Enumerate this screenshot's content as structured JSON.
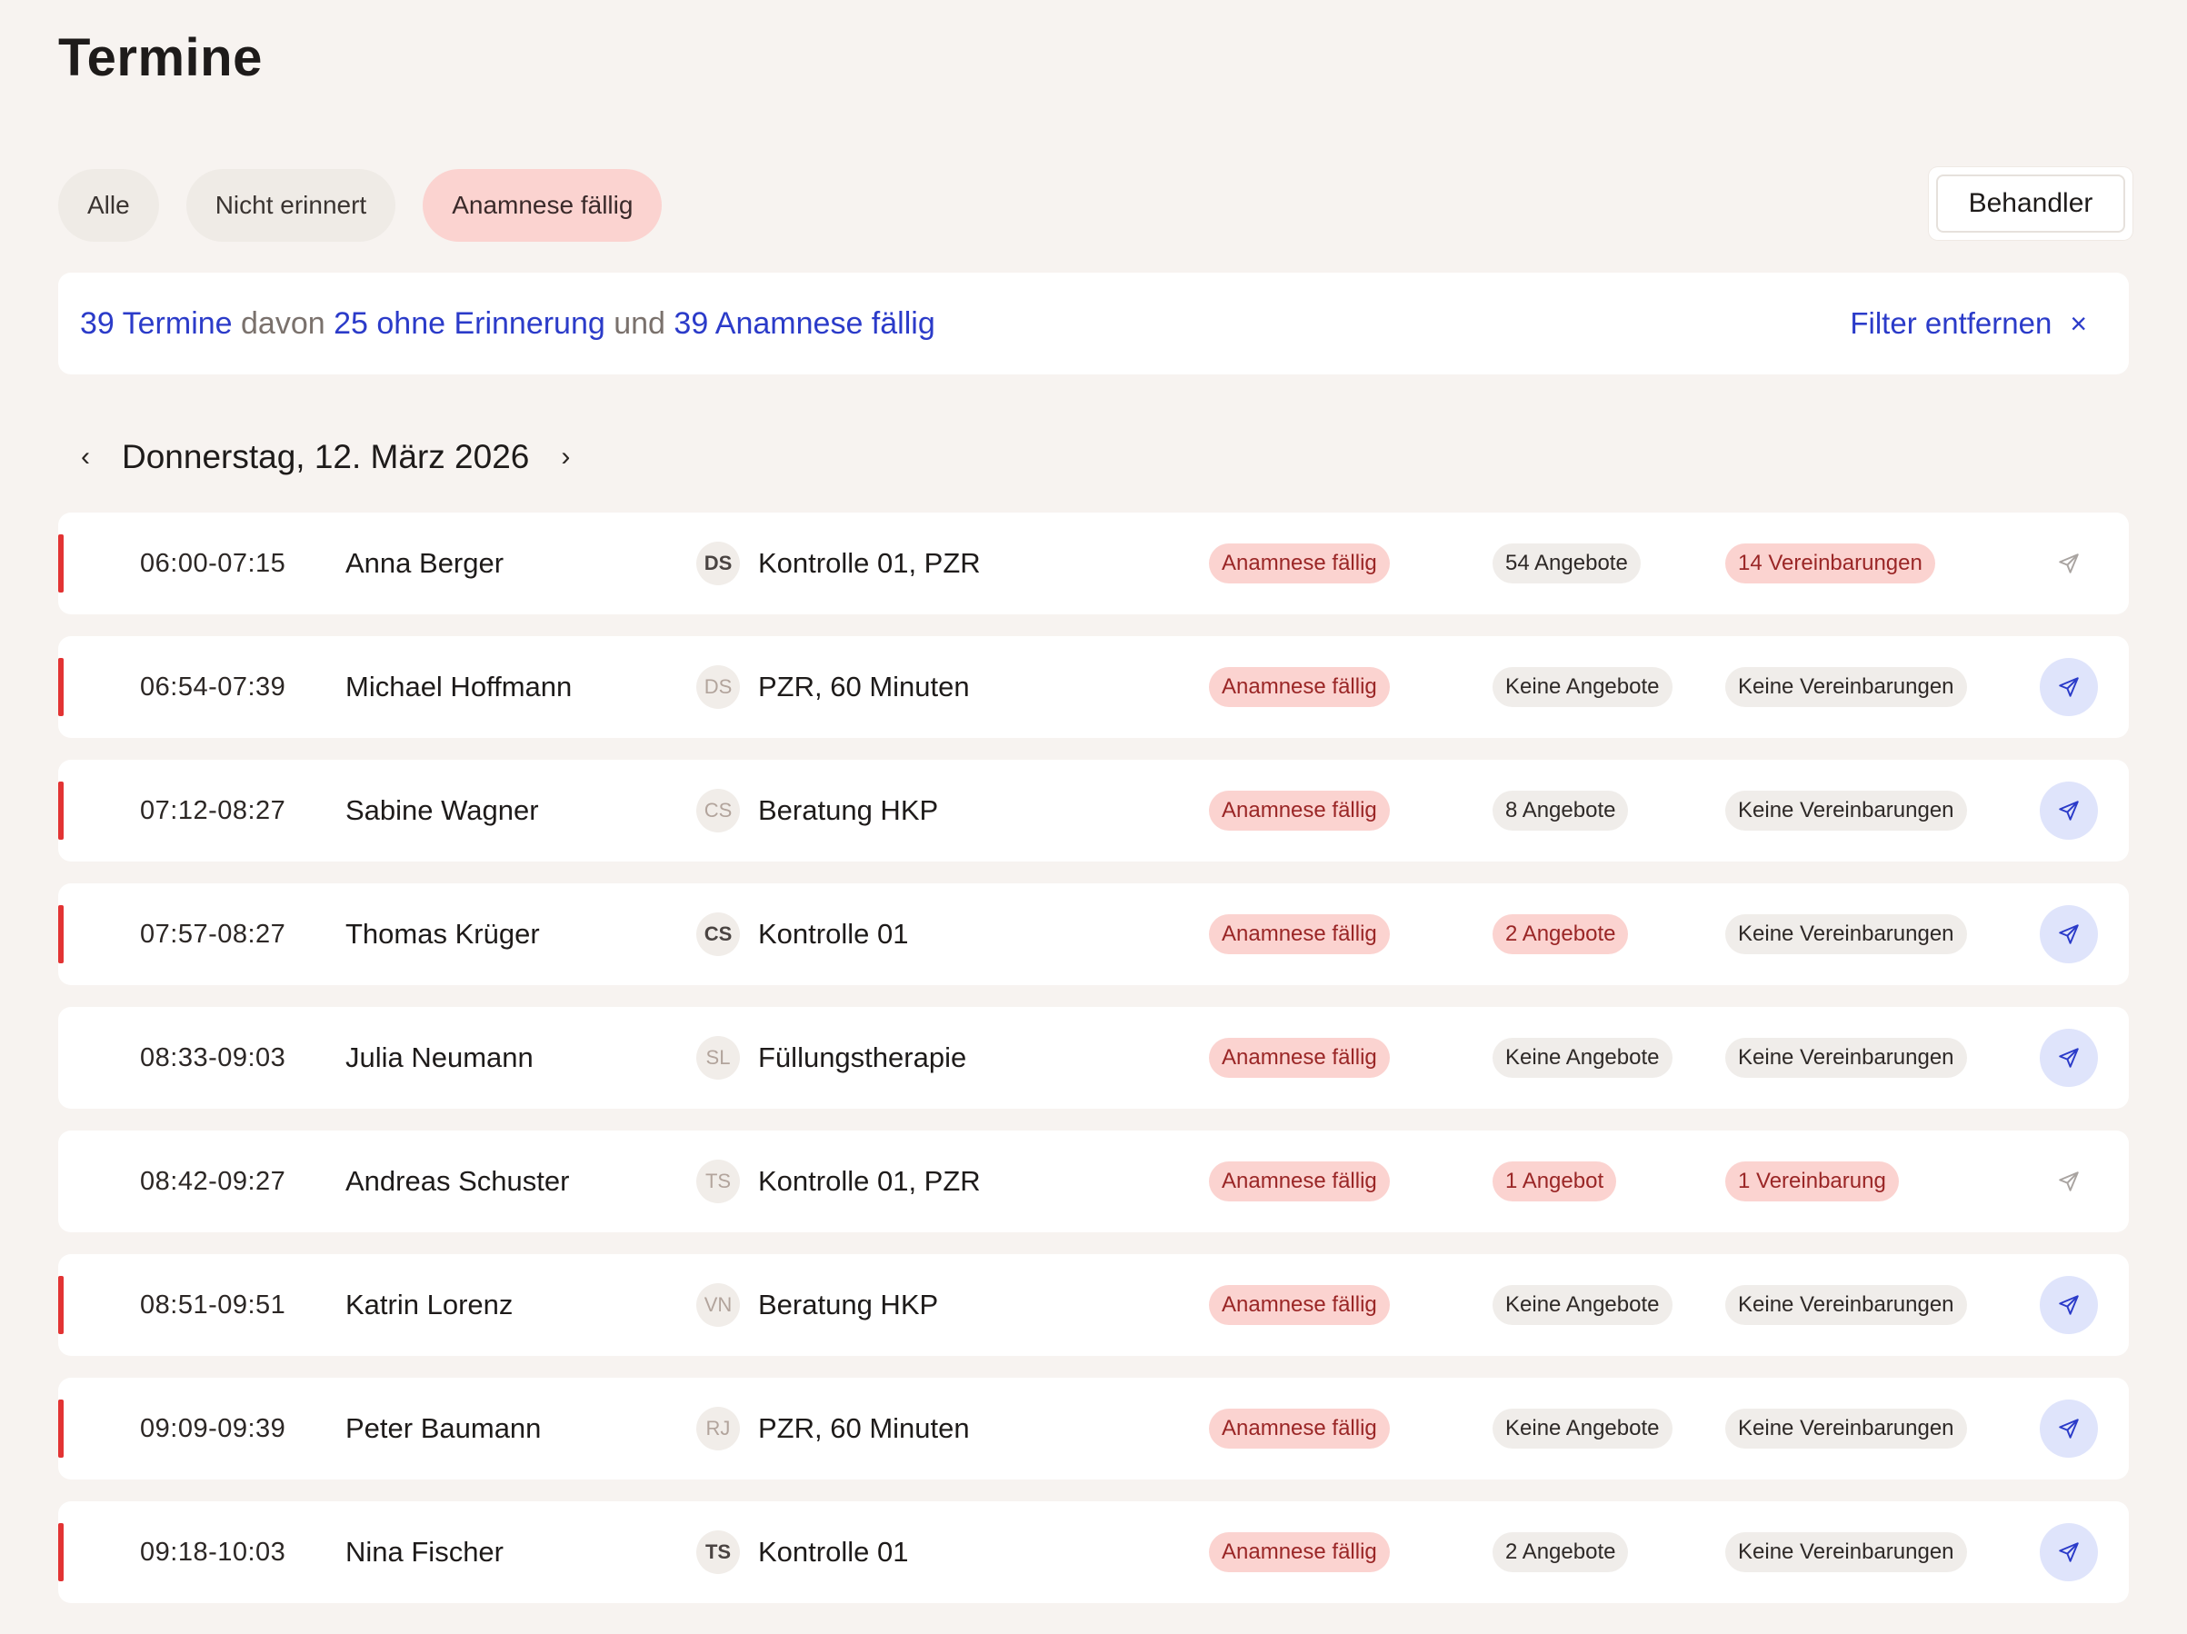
{
  "page": {
    "title": "Termine"
  },
  "filters": [
    {
      "label": "Alle",
      "active": false
    },
    {
      "label": "Nicht erinnert",
      "active": false
    },
    {
      "label": "Anamnese fällig",
      "active": true
    }
  ],
  "behandler": {
    "label": "Behandler"
  },
  "summary": {
    "part1": "39 Termine",
    "sep1": " davon ",
    "part2": "25 ohne Erinnerung",
    "sep2": " und ",
    "part3": "39 Anamnese fällig",
    "clear_label": "Filter entfernen",
    "clear_icon": "×"
  },
  "datenav": {
    "prev_icon": "‹",
    "date": "Donnerstag, 12. März 2026",
    "next_icon": "›"
  },
  "rows": [
    {
      "time": "06:00-07:15",
      "name": "Anna Berger",
      "avatar": "DS",
      "avatar_strong": true,
      "treatment": "Kontrolle 01, PZR",
      "anamnese": "Anamnese fällig",
      "angebote": "54 Angebote",
      "angebote_red": false,
      "vereinbarungen": "14 Vereinbarungen",
      "vereinbarungen_red": true,
      "marker": true,
      "send_active": false
    },
    {
      "time": "06:54-07:39",
      "name": "Michael Hoffmann",
      "avatar": "DS",
      "avatar_strong": false,
      "treatment": "PZR, 60 Minuten",
      "anamnese": "Anamnese fällig",
      "angebote": "Keine Angebote",
      "angebote_red": false,
      "vereinbarungen": "Keine Vereinbarungen",
      "vereinbarungen_red": false,
      "marker": true,
      "send_active": true
    },
    {
      "time": "07:12-08:27",
      "name": "Sabine Wagner",
      "avatar": "CS",
      "avatar_strong": false,
      "treatment": "Beratung HKP",
      "anamnese": "Anamnese fällig",
      "angebote": "8 Angebote",
      "angebote_red": false,
      "vereinbarungen": "Keine Vereinbarungen",
      "vereinbarungen_red": false,
      "marker": true,
      "send_active": true
    },
    {
      "time": "07:57-08:27",
      "name": "Thomas Krüger",
      "avatar": "CS",
      "avatar_strong": true,
      "treatment": "Kontrolle 01",
      "anamnese": "Anamnese fällig",
      "angebote": "2 Angebote",
      "angebote_red": true,
      "vereinbarungen": "Keine Vereinbarungen",
      "vereinbarungen_red": false,
      "marker": true,
      "send_active": true
    },
    {
      "time": "08:33-09:03",
      "name": "Julia Neumann",
      "avatar": "SL",
      "avatar_strong": false,
      "treatment": "Füllungstherapie",
      "anamnese": "Anamnese fällig",
      "angebote": "Keine Angebote",
      "angebote_red": false,
      "vereinbarungen": "Keine Vereinbarungen",
      "vereinbarungen_red": false,
      "marker": false,
      "send_active": true
    },
    {
      "time": "08:42-09:27",
      "name": "Andreas Schuster",
      "avatar": "TS",
      "avatar_strong": false,
      "treatment": "Kontrolle 01, PZR",
      "anamnese": "Anamnese fällig",
      "angebote": "1 Angebot",
      "angebote_red": true,
      "vereinbarungen": "1 Vereinbarung",
      "vereinbarungen_red": true,
      "marker": false,
      "send_active": false
    },
    {
      "time": "08:51-09:51",
      "name": "Katrin Lorenz",
      "avatar": "VN",
      "avatar_strong": false,
      "treatment": "Beratung HKP",
      "anamnese": "Anamnese fällig",
      "angebote": "Keine Angebote",
      "angebote_red": false,
      "vereinbarungen": "Keine Vereinbarungen",
      "vereinbarungen_red": false,
      "marker": true,
      "send_active": true
    },
    {
      "time": "09:09-09:39",
      "name": "Peter Baumann",
      "avatar": "RJ",
      "avatar_strong": false,
      "treatment": "PZR, 60 Minuten",
      "anamnese": "Anamnese fällig",
      "angebote": "Keine Angebote",
      "angebote_red": false,
      "vereinbarungen": "Keine Vereinbarungen",
      "vereinbarungen_red": false,
      "marker": true,
      "send_active": true
    },
    {
      "time": "09:18-10:03",
      "name": "Nina Fischer",
      "avatar": "TS",
      "avatar_strong": true,
      "treatment": "Kontrolle 01",
      "anamnese": "Anamnese fällig",
      "angebote": "2 Angebote",
      "angebote_red": false,
      "vereinbarungen": "Keine Vereinbarungen",
      "vereinbarungen_red": false,
      "marker": true,
      "send_active": true
    }
  ],
  "colors": {
    "accent": "#2b3bc9",
    "alert": "#e23333",
    "pill_red_bg": "#fbd3d0",
    "send_active_bg": "#dfe4fb"
  },
  "icons": {
    "send": "send-icon"
  }
}
